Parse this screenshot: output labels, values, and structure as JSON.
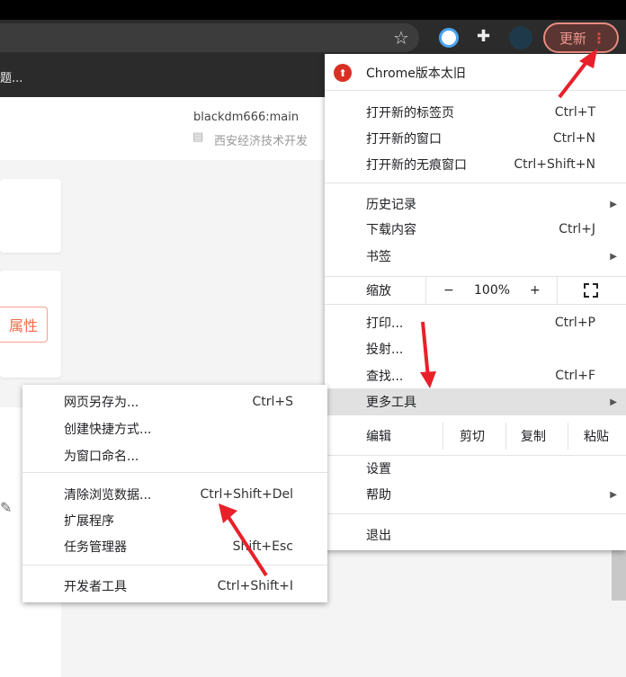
{
  "browser": {
    "update_label": "更新",
    "bookmark_text": "题...",
    "star_icon": "star-icon"
  },
  "page": {
    "repo": "blackdm666:main",
    "org": "西安经济技术开发",
    "property_button": "属性"
  },
  "menu": {
    "update_notice": "Chrome版本太旧",
    "new_tab": {
      "label": "打开新的标签页",
      "shortcut": "Ctrl+T"
    },
    "new_window": {
      "label": "打开新的窗口",
      "shortcut": "Ctrl+N"
    },
    "incognito": {
      "label": "打开新的无痕窗口",
      "shortcut": "Ctrl+Shift+N"
    },
    "history": {
      "label": "历史记录"
    },
    "downloads": {
      "label": "下载内容",
      "shortcut": "Ctrl+J"
    },
    "bookmarks": {
      "label": "书签"
    },
    "zoom": {
      "label": "缩放",
      "minus": "−",
      "value": "100%",
      "plus": "+"
    },
    "print": {
      "label": "打印...",
      "shortcut": "Ctrl+P"
    },
    "cast": {
      "label": "投射..."
    },
    "find": {
      "label": "查找...",
      "shortcut": "Ctrl+F"
    },
    "more_tools": {
      "label": "更多工具"
    },
    "edit": {
      "label": "编辑",
      "cut": "剪切",
      "copy": "复制",
      "paste": "粘贴"
    },
    "settings": {
      "label": "设置"
    },
    "help": {
      "label": "帮助"
    },
    "exit": {
      "label": "退出"
    }
  },
  "submenu": {
    "save_page": {
      "label": "网页另存为...",
      "shortcut": "Ctrl+S"
    },
    "create_shortcut": {
      "label": "创建快捷方式..."
    },
    "name_window": {
      "label": "为窗口命名..."
    },
    "clear_data": {
      "label": "清除浏览数据...",
      "shortcut": "Ctrl+Shift+Del"
    },
    "extensions": {
      "label": "扩展程序"
    },
    "task_manager": {
      "label": "任务管理器",
      "shortcut": "Shift+Esc"
    },
    "devtools": {
      "label": "开发者工具",
      "shortcut": "Ctrl+Shift+I"
    }
  },
  "colors": {
    "accent": "#e8453c",
    "annotation": "#e8202a"
  }
}
